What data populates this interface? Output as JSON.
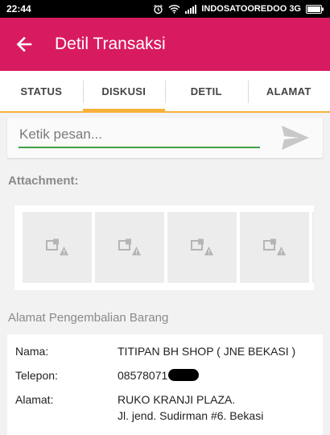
{
  "status_bar": {
    "time": "22:44",
    "carrier": "INDOSATOOREDOO 3G",
    "icons": [
      "alarm-icon",
      "wifi-icon",
      "signal-icon",
      "battery-icon"
    ]
  },
  "app_bar": {
    "title": "Detil Transaksi",
    "back_icon": "arrow-left-icon",
    "color": "#d81b60"
  },
  "tabs": [
    {
      "label": "STATUS",
      "active": false
    },
    {
      "label": "DISKUSI",
      "active": true
    },
    {
      "label": "DETIL",
      "active": false
    },
    {
      "label": "ALAMAT",
      "active": false
    }
  ],
  "tab_accent_color": "#f6b13b",
  "composer": {
    "placeholder": "Ketik pesan...",
    "value": "",
    "send_icon": "send-icon",
    "underline_color": "#43a047"
  },
  "attachments": {
    "title": "Attachment:",
    "thumbnail_icon": "broken-image-icon",
    "count": 4
  },
  "return_address": {
    "title": "Alamat Pengembalian Barang",
    "name_label": "Nama:",
    "name_value": "TITIPAN BH SHOP ( JNE BEKASI )",
    "phone_label": "Telepon:",
    "phone_value": "08578071",
    "address_label": "Alamat:",
    "address_line1": "RUKO KRANJI PLAZA.",
    "address_line2": "Jl. jend. Sudirman #6. Bekasi"
  }
}
